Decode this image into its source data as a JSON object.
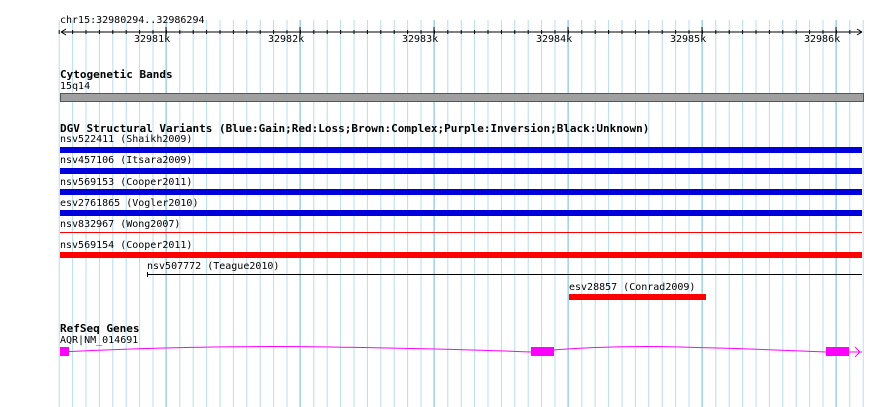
{
  "ruler": {
    "region": "chr15:32980294..32986294",
    "ticks": [
      "32981k",
      "32982k",
      "32983k",
      "32984k",
      "32985k",
      "32986k"
    ]
  },
  "cytoband": {
    "title": "Cytogenetic Bands",
    "band": "15q14"
  },
  "dgv": {
    "title": "DGV Structural Variants (Blue:Gain;Red:Loss;Brown:Complex;Purple:Inversion;Black:Unknown)",
    "features": [
      {
        "label": "nsv522411 (Shaikh2009)",
        "type": "gain",
        "color": "#0000dd"
      },
      {
        "label": "nsv457106 (Itsara2009)",
        "type": "gain",
        "color": "#0000dd"
      },
      {
        "label": "nsv569153 (Cooper2011)",
        "type": "gain",
        "color": "#0000dd"
      },
      {
        "label": "esv2761865 (Vogler2010)",
        "type": "gain",
        "color": "#0000dd"
      },
      {
        "label": "nsv832967 (Wong2007)",
        "type": "loss",
        "color": "#ff0000"
      },
      {
        "label": "nsv569154 (Cooper2011)",
        "type": "loss",
        "color": "#ff0000"
      },
      {
        "label": "nsv507772 (Teague2010)",
        "type": "unknown",
        "color": "#000000"
      },
      {
        "label": "esv28857 (Conrad2009)",
        "type": "loss",
        "color": "#ff0000"
      }
    ]
  },
  "refseq": {
    "title": "RefSeq Genes",
    "gene": "AQR|NM_014691",
    "color": "#ff00ff"
  }
}
